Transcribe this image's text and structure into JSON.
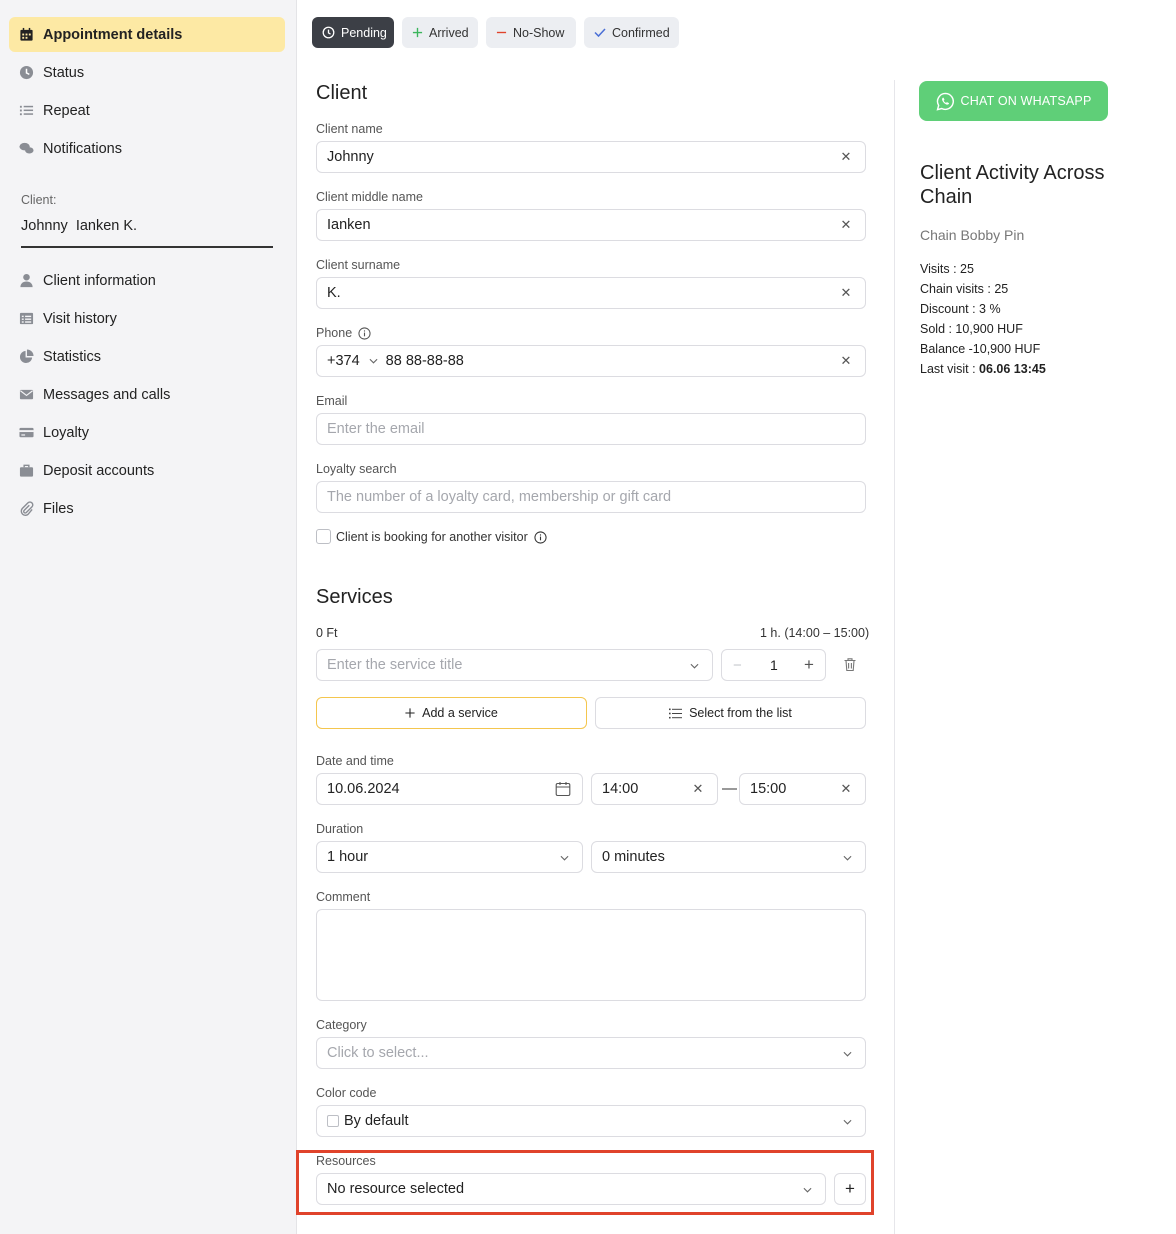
{
  "sidebar": {
    "items_top": [
      {
        "label": "Appointment details",
        "icon": "calendar-icon",
        "active": true
      },
      {
        "label": "Status",
        "icon": "clock-icon"
      },
      {
        "label": "Repeat",
        "icon": "list-icon"
      },
      {
        "label": "Notifications",
        "icon": "chat-bubbles-icon"
      }
    ],
    "client_label": "Client:",
    "client_value": "Johnny  Ianken K.",
    "items_bottom": [
      {
        "label": "Client information",
        "icon": "user-icon"
      },
      {
        "label": "Visit history",
        "icon": "table-icon"
      },
      {
        "label": "Statistics",
        "icon": "pie-chart-icon"
      },
      {
        "label": "Messages and calls",
        "icon": "envelope-icon"
      },
      {
        "label": "Loyalty",
        "icon": "card-icon"
      },
      {
        "label": "Deposit accounts",
        "icon": "briefcase-icon"
      },
      {
        "label": "Files",
        "icon": "paperclip-icon"
      }
    ]
  },
  "status_bar": {
    "pending": "Pending",
    "arrived": "Arrived",
    "noshow": "No-Show",
    "confirmed": "Confirmed"
  },
  "client_section": {
    "title": "Client",
    "name_label": "Client name",
    "name_value": "Johnny",
    "middle_label": "Client middle name",
    "middle_value": "Ianken",
    "surname_label": "Client surname",
    "surname_value": "K.",
    "phone_label": "Phone",
    "phone_code": "+374",
    "phone_number": "88 88-88-88",
    "email_label": "Email",
    "email_placeholder": "Enter the email",
    "loyalty_label": "Loyalty search",
    "loyalty_placeholder": "The number of a loyalty card, membership or gift card",
    "another_visitor": "Client is booking for another visitor"
  },
  "services_section": {
    "title": "Services",
    "price": "0 Ft",
    "duration_summary": "1 h. (14:00 – 15:00)",
    "service_placeholder": "Enter the service title",
    "minus": "−",
    "quantity": "1",
    "plus": "+",
    "add_service": "Add a service",
    "select_from_list": "Select from the list"
  },
  "datetime": {
    "label": "Date and time",
    "date": "10.06.2024",
    "start": "14:00",
    "dash": "—",
    "end": "15:00"
  },
  "duration": {
    "label": "Duration",
    "hours": "1 hour",
    "minutes": "0 minutes"
  },
  "comment": {
    "label": "Comment"
  },
  "category": {
    "label": "Category",
    "placeholder": "Click to select..."
  },
  "color_code": {
    "label": "Color code",
    "value": "By default"
  },
  "resources": {
    "label": "Resources",
    "value": "No resource selected",
    "add": "+"
  },
  "right_panel": {
    "whatsapp": "CHAT ON WHATSAPP",
    "activity_title": "Client Activity Across Chain",
    "chain_name": "Chain Bobby Pin",
    "visits": "Visits : 25",
    "chain_visits": "Chain visits : 25",
    "discount": "Discount : 3 %",
    "sold": "Sold : 10,900 HUF",
    "balance": "Balance -10,900 HUF",
    "last_visit_label": "Last visit : ",
    "last_visit_value": "06.06 13:45"
  },
  "colors": {
    "active_nav": "#fde9a4",
    "whatsapp_green": "#5fcf78",
    "highlight_red": "#e0432b",
    "accent_yellow": "#f4c64e"
  }
}
